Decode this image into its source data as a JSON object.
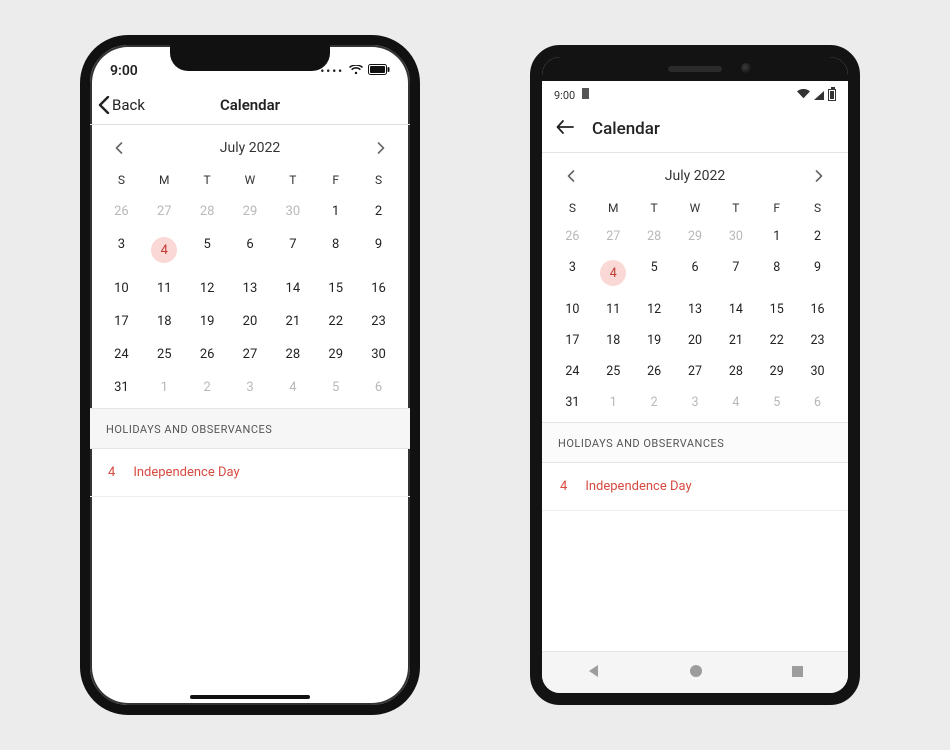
{
  "ios": {
    "status_time": "9:00",
    "nav_back": "Back",
    "nav_title": "Calendar"
  },
  "android": {
    "status_time": "9:00",
    "nav_title": "Calendar"
  },
  "calendar": {
    "month_label": "July 2022",
    "dow": [
      "S",
      "M",
      "T",
      "W",
      "T",
      "F",
      "S"
    ],
    "cells": [
      {
        "d": "26",
        "out": true
      },
      {
        "d": "27",
        "out": true
      },
      {
        "d": "28",
        "out": true
      },
      {
        "d": "29",
        "out": true
      },
      {
        "d": "30",
        "out": true
      },
      {
        "d": "1"
      },
      {
        "d": "2"
      },
      {
        "d": "3"
      },
      {
        "d": "4",
        "hi": true
      },
      {
        "d": "5"
      },
      {
        "d": "6"
      },
      {
        "d": "7"
      },
      {
        "d": "8"
      },
      {
        "d": "9"
      },
      {
        "d": "10"
      },
      {
        "d": "11"
      },
      {
        "d": "12"
      },
      {
        "d": "13"
      },
      {
        "d": "14"
      },
      {
        "d": "15"
      },
      {
        "d": "16"
      },
      {
        "d": "17"
      },
      {
        "d": "18"
      },
      {
        "d": "19"
      },
      {
        "d": "20"
      },
      {
        "d": "21"
      },
      {
        "d": "22"
      },
      {
        "d": "23"
      },
      {
        "d": "24"
      },
      {
        "d": "25"
      },
      {
        "d": "26"
      },
      {
        "d": "27"
      },
      {
        "d": "28"
      },
      {
        "d": "29"
      },
      {
        "d": "30"
      },
      {
        "d": "31"
      },
      {
        "d": "1",
        "out": true
      },
      {
        "d": "2",
        "out": true
      },
      {
        "d": "3",
        "out": true
      },
      {
        "d": "4",
        "out": true
      },
      {
        "d": "5",
        "out": true
      },
      {
        "d": "6",
        "out": true
      }
    ],
    "section_title": "HOLIDAYS AND OBSERVANCES",
    "holiday_day": "4",
    "holiday_name": "Independence Day"
  },
  "colors": {
    "accent": "#d84b41"
  }
}
